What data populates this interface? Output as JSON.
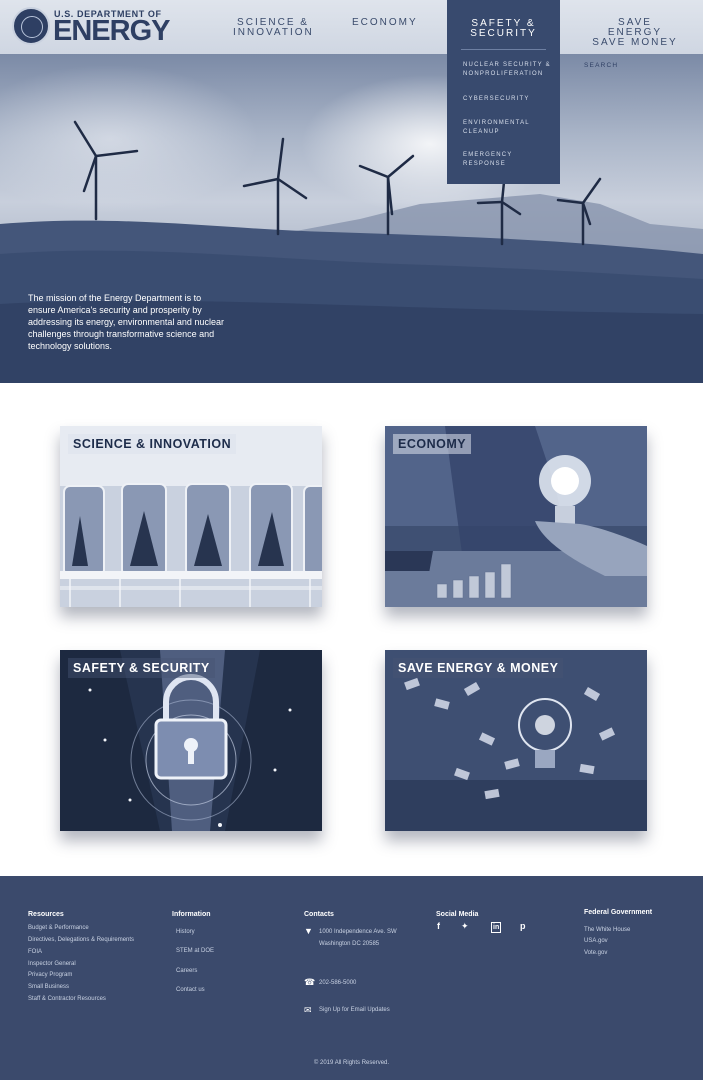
{
  "header": {
    "logo_top": "U.S. DEPARTMENT OF",
    "logo_main": "ENERGY",
    "nav": {
      "science": [
        "SCIENCE &",
        "INNOVATION"
      ],
      "economy": "ECONOMY",
      "safety": [
        "SAFETY &",
        "SECURITY"
      ],
      "save": [
        "SAVE ENERGY",
        "SAVE MONEY"
      ]
    },
    "dropdown": [
      [
        "NUCLEAR SECURITY &",
        "NONPROLIFERATION"
      ],
      [
        "CYBERSECURITY"
      ],
      [
        "ENVIRONMENTAL",
        "CLEANUP"
      ],
      [
        "EMERGENCY",
        "RESPONSE"
      ]
    ],
    "search_label": "SEARCH"
  },
  "hero": {
    "mission_text": "The mission of the Energy Department is to ensure America's security and prosperity by addressing its energy, environmental and nuclear challenges through transformative science and technology solutions."
  },
  "cards": {
    "science": "SCIENCE & INNOVATION",
    "economy": "ECONOMY",
    "safety": "SAFETY & SECURITY",
    "save": "SAVE ENERGY & MONEY"
  },
  "footer": {
    "resources": {
      "heading": "Resources",
      "links": [
        "Budget & Performance",
        "Directives, Delegations & Requirements",
        "FOIA",
        "Inspector General",
        "Privacy Program",
        "Small Business",
        "Staff & Contractor Resources"
      ]
    },
    "information": {
      "heading": "Information",
      "links": [
        "History",
        "STEM at DOE",
        "Careers",
        "Contact us"
      ]
    },
    "contacts": {
      "heading": "Contacts",
      "address_line1": "1000 Independence Ave. SW",
      "address_line2": "Washington DC 20585",
      "phone": "202-586-5000",
      "email": "Sign Up for Email Updates",
      "icons": [
        "location-pin-icon",
        "phone-icon",
        "envelope-icon"
      ]
    },
    "social": {
      "heading": "Social Media",
      "icons": [
        "facebook-icon",
        "twitter-icon",
        "linkedin-icon",
        "pinterest-icon"
      ]
    },
    "federal": {
      "heading": "Federal Government",
      "links": [
        "The White House",
        "USA.gov",
        "Vote.gov"
      ]
    },
    "copyright": "© 2019 All Rights Reserved."
  },
  "colors": {
    "navy": "#384a6e",
    "footer_bg": "#3b4a6c",
    "header_bg": "#d5dbe6"
  }
}
